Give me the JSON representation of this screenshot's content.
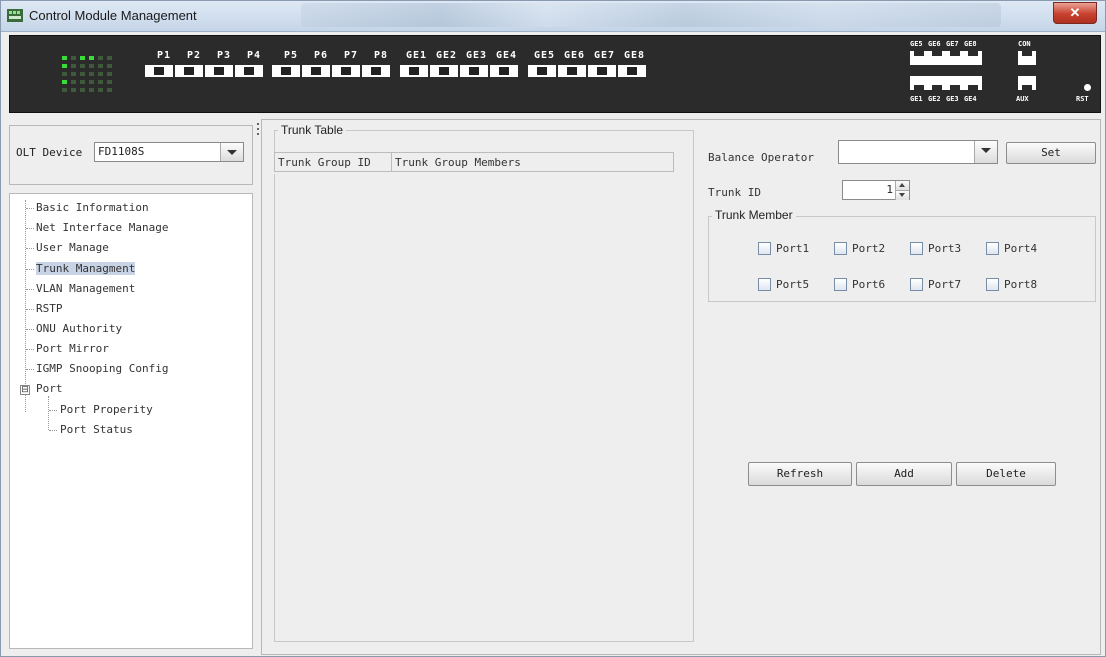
{
  "window": {
    "title": "Control Module Management",
    "close_icon": "✕"
  },
  "device_panel": {
    "ports": [
      "P1",
      "P2",
      "P3",
      "P4",
      "P5",
      "P6",
      "P7",
      "P8",
      "GE1",
      "GE2",
      "GE3",
      "GE4",
      "GE5",
      "GE6",
      "GE7",
      "GE8"
    ],
    "top_labels": [
      "GE5",
      "GE6",
      "GE7",
      "GE8",
      "CON"
    ],
    "bottom_labels": [
      "GE1",
      "GE2",
      "GE3",
      "GE4",
      "AUX",
      "RST"
    ]
  },
  "left": {
    "olt_label": "OLT Device",
    "olt_value": "FD1108S",
    "tree": [
      {
        "label": "Basic Information"
      },
      {
        "label": "Net Interface Manage"
      },
      {
        "label": "User Manage"
      },
      {
        "label": "Trunk Managment",
        "selected": true
      },
      {
        "label": "VLAN Management"
      },
      {
        "label": "RSTP"
      },
      {
        "label": "ONU Authority"
      },
      {
        "label": "Port Mirror"
      },
      {
        "label": "IGMP Snooping Config"
      },
      {
        "label": "Port",
        "expander": "⊟"
      },
      {
        "label": "Port Properity",
        "child": true
      },
      {
        "label": "Port Status",
        "child": true
      }
    ]
  },
  "trunk_table": {
    "legend": "Trunk Table",
    "columns": [
      "Trunk Group ID",
      "Trunk Group Members"
    ]
  },
  "right": {
    "balance_label": "Balance Operator",
    "balance_value": "",
    "set_label": "Set",
    "trunk_id_label": "Trunk ID",
    "trunk_id_value": "1",
    "member_legend": "Trunk Member",
    "ports_row1": [
      "Port1",
      "Port2",
      "Port3",
      "Port4"
    ],
    "ports_row2": [
      "Port5",
      "Port6",
      "Port7",
      "Port8"
    ],
    "refresh_label": "Refresh",
    "add_label": "Add",
    "delete_label": "Delete"
  }
}
